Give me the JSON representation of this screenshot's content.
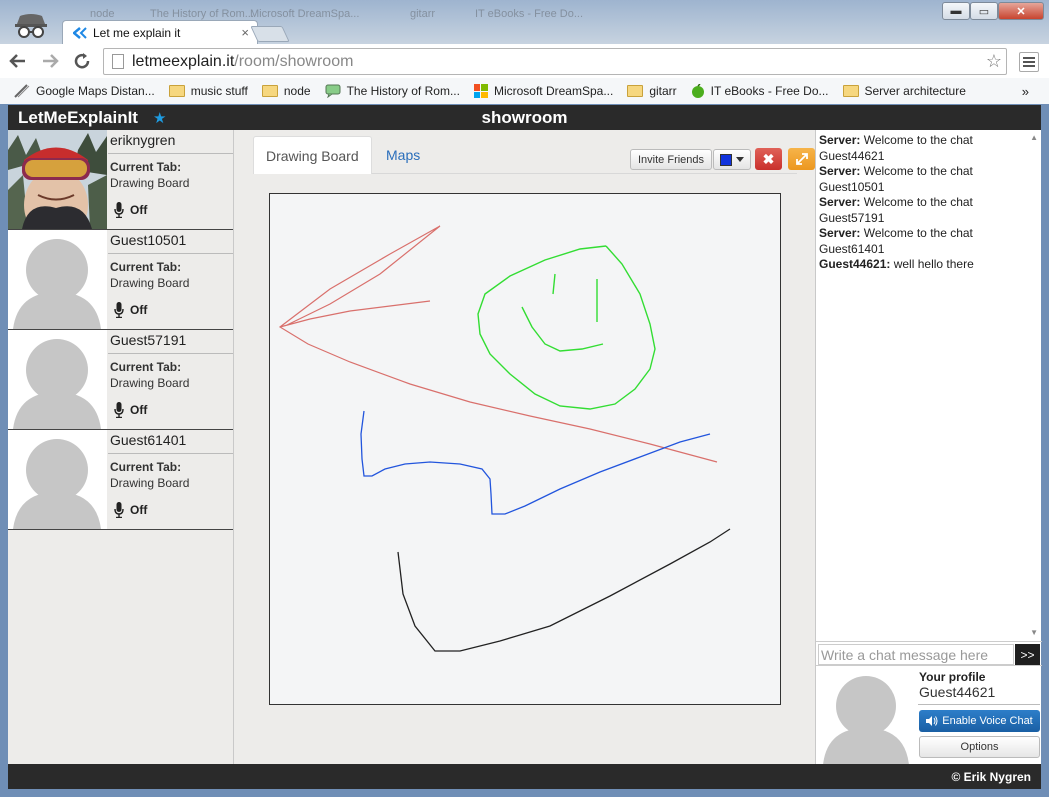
{
  "browser": {
    "tab_title": "Let me explain it",
    "background_tabs": [
      "node",
      "The History of Rom...",
      "Microsoft DreamSpa...",
      "gitarr",
      "IT eBooks - Free Do..."
    ],
    "url_domain": "letmeexplain.it",
    "url_path": "/room/showroom",
    "bookmarks": [
      "Google Maps Distan...",
      "music stuff",
      "node",
      "The History of Rom...",
      "Microsoft DreamSpa...",
      "gitarr",
      "IT eBooks - Free Do...",
      "Server architecture"
    ],
    "bookmarks_more": "»",
    "window_controls": {
      "minimize": "▬",
      "maximize": "▭",
      "close": "✕"
    }
  },
  "app": {
    "brand": "LetMeExplainIt",
    "room_title": "showroom",
    "footer": "© Erik Nygren"
  },
  "users": [
    {
      "name": "eriknygren",
      "tab_label": "Current Tab:",
      "tab_value": "Drawing Board",
      "mic_status": "Off",
      "avatar": "photo"
    },
    {
      "name": "Guest10501",
      "tab_label": "Current Tab:",
      "tab_value": "Drawing Board",
      "mic_status": "Off",
      "avatar": "placeholder"
    },
    {
      "name": "Guest57191",
      "tab_label": "Current Tab:",
      "tab_value": "Drawing Board",
      "mic_status": "Off",
      "avatar": "placeholder"
    },
    {
      "name": "Guest61401",
      "tab_label": "Current Tab:",
      "tab_value": "Drawing Board",
      "mic_status": "Off",
      "avatar": "placeholder"
    }
  ],
  "main": {
    "tabs": [
      {
        "label": "Drawing Board",
        "active": true
      },
      {
        "label": "Maps",
        "active": false
      }
    ],
    "invite_label": "Invite Friends",
    "pen_color": "#1133dd",
    "stroke_colors": {
      "red": "#d9706c",
      "green": "#33dd33",
      "blue": "#2255dd",
      "black": "#222222"
    }
  },
  "chat": {
    "messages": [
      {
        "sender": "Server:",
        "text": "Welcome to the chat Guest44621"
      },
      {
        "sender": "Server:",
        "text": "Welcome to the chat Guest10501"
      },
      {
        "sender": "Server:",
        "text": "Welcome to the chat Guest57191"
      },
      {
        "sender": "Server:",
        "text": "Welcome to the chat Guest61401"
      },
      {
        "sender": "Guest44621:",
        "text": "well hello there"
      }
    ],
    "input_placeholder": "Write a chat message here",
    "send_label": ">>"
  },
  "profile": {
    "label": "Your profile",
    "name": "Guest44621",
    "voice_label": "Enable Voice Chat",
    "options_label": "Options"
  },
  "colors": {
    "topbar": "#2a2a2a",
    "accent_blue": "#1a5fa4",
    "danger": "#c9302c",
    "warning": "#ec971f",
    "link": "#2a6ebb"
  }
}
